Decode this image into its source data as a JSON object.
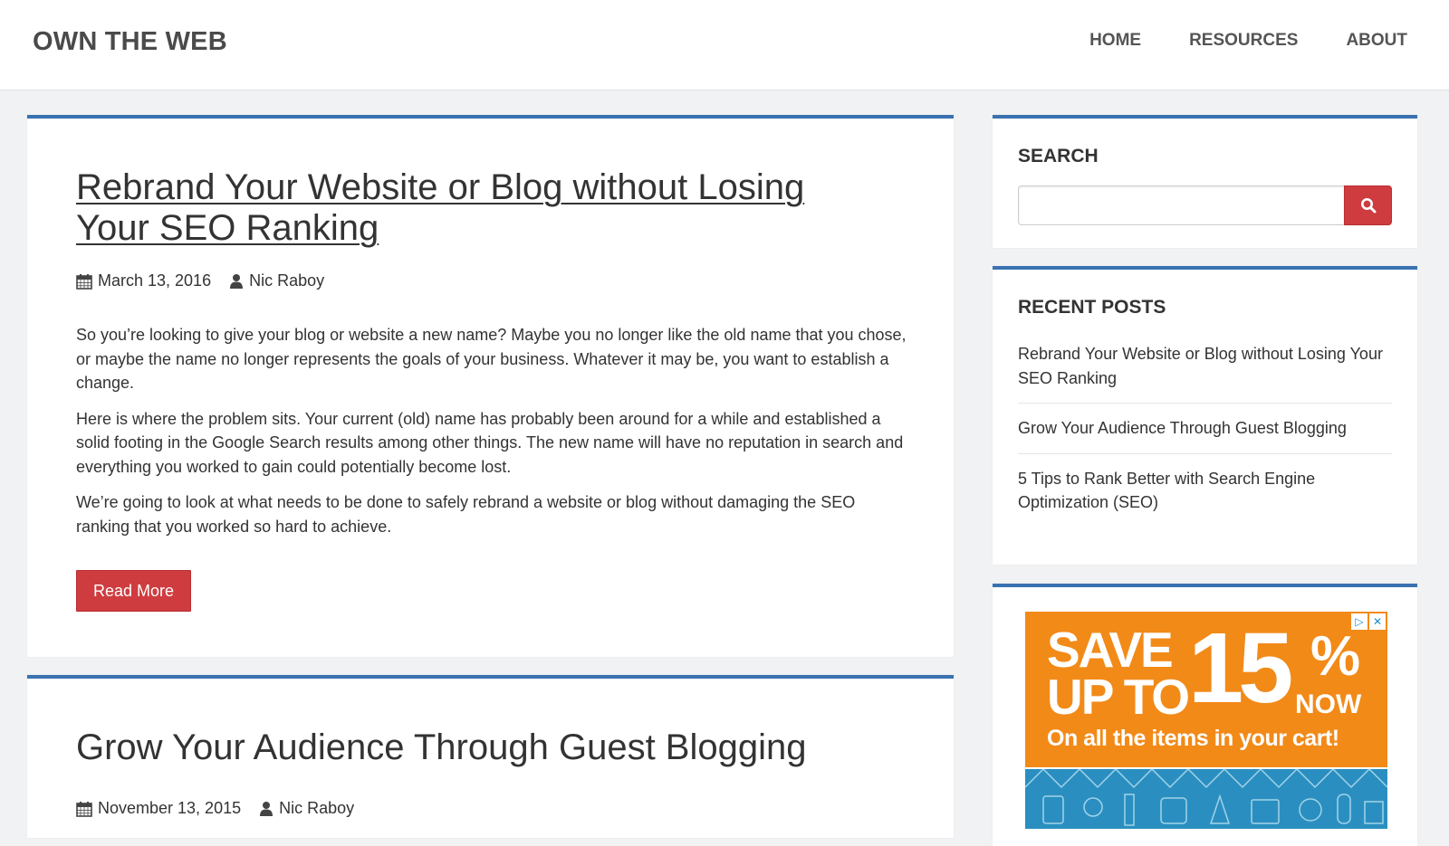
{
  "header": {
    "brand": "OWN THE WEB",
    "nav": [
      "HOME",
      "RESOURCES",
      "ABOUT"
    ]
  },
  "posts": [
    {
      "title": "Rebrand Your Website or Blog without Losing Your SEO Ranking",
      "date": "March 13, 2016",
      "author": "Nic Raboy",
      "paragraphs": [
        "So you’re looking to give your blog or website a new name? Maybe you no longer like the old name that you chose, or maybe the name no longer represents the goals of your business. Whatever it may be, you want to establish a change.",
        "Here is where the problem sits. Your current (old) name has probably been around for a while and established a solid footing in the Google Search results among other things. The new name will have no reputation in search and everything you worked to gain could potentially become lost.",
        "We’re going to look at what needs to be done to safely rebrand a website or blog without damaging the SEO ranking that you worked so hard to achieve."
      ],
      "read_more": "Read More"
    },
    {
      "title": "Grow Your Audience Through Guest Blogging",
      "date": "November 13, 2015",
      "author": "Nic Raboy"
    }
  ],
  "sidebar": {
    "search": {
      "title": "SEARCH",
      "value": "",
      "placeholder": "",
      "button_icon": "search-icon"
    },
    "recent": {
      "title": "RECENT POSTS",
      "items": [
        "Rebrand Your Website or Blog without Losing Your SEO Ranking",
        "Grow Your Audience Through Guest Blogging",
        "5 Tips to Rank Better with Search Engine Optimization (SEO)"
      ]
    },
    "ad": {
      "save": "SAVE",
      "upto": "UP TO",
      "percent": "15",
      "percent_sign": "%",
      "now": "NOW",
      "subtitle": "On all the items in your cart!"
    }
  },
  "colors": {
    "accent_blue": "#3a72b0",
    "button_red": "#cf3c3f",
    "ad_orange": "#f28a18",
    "ad_blue": "#2a8fc0"
  }
}
